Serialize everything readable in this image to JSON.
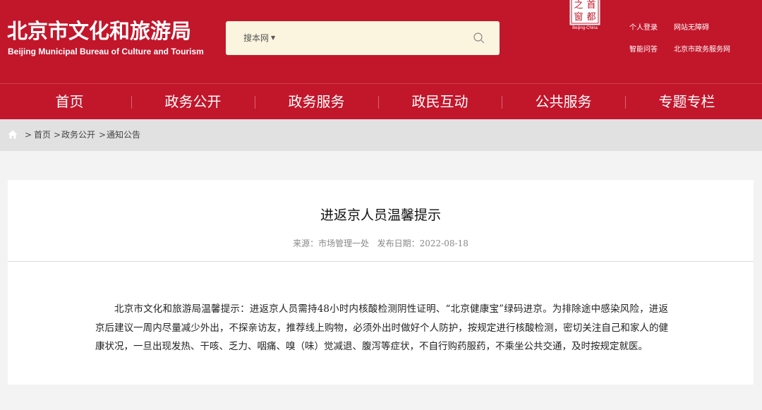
{
  "header": {
    "logo_cn": "北京市文化和旅游局",
    "logo_en": "Beijing Municipal Bureau of Culture and Tourism",
    "seal_text": [
      "首",
      "都",
      "之",
      "窗"
    ],
    "seal_caption": "Beijing-China",
    "links": [
      "个人登录",
      "网站无障碍",
      "智能问答",
      "北京市政务服务网"
    ]
  },
  "search": {
    "scope": "搜本网",
    "placeholder": ""
  },
  "nav": {
    "items": [
      "首页",
      "政务公开",
      "政务服务",
      "政民互动",
      "公共服务",
      "专题专栏"
    ]
  },
  "breadcrumb": {
    "separator": ">",
    "items": [
      "首页",
      "政务公开",
      "通知公告"
    ]
  },
  "article": {
    "title": "进返京人员温馨提示",
    "source_label": "来源：",
    "source": "市场管理一处",
    "date_label": "发布日期：",
    "date": "2022-08-18",
    "body": "北京市文化和旅游局温馨提示：进返京人员需持48小时内核酸检测阴性证明、“北京健康宝”绿码进京。为排除途中感染风险，进返京后建议一周内尽量减少外出，不探亲访友，推荐线上购物，必须外出时做好个人防护，按规定进行核酸检测，密切关注自己和家人的健康状况，一旦出现发热、干咳、乏力、咽痛、嗅（味）觉减退、腹泻等症状，不自行购药服药，不乘坐公共交通，及时按规定就医。"
  },
  "colors": {
    "brand_red": "#c2162b",
    "search_bg": "#fbf5df",
    "crumb_bg": "#e1e1e1",
    "page_bg": "#f3f3f3"
  }
}
